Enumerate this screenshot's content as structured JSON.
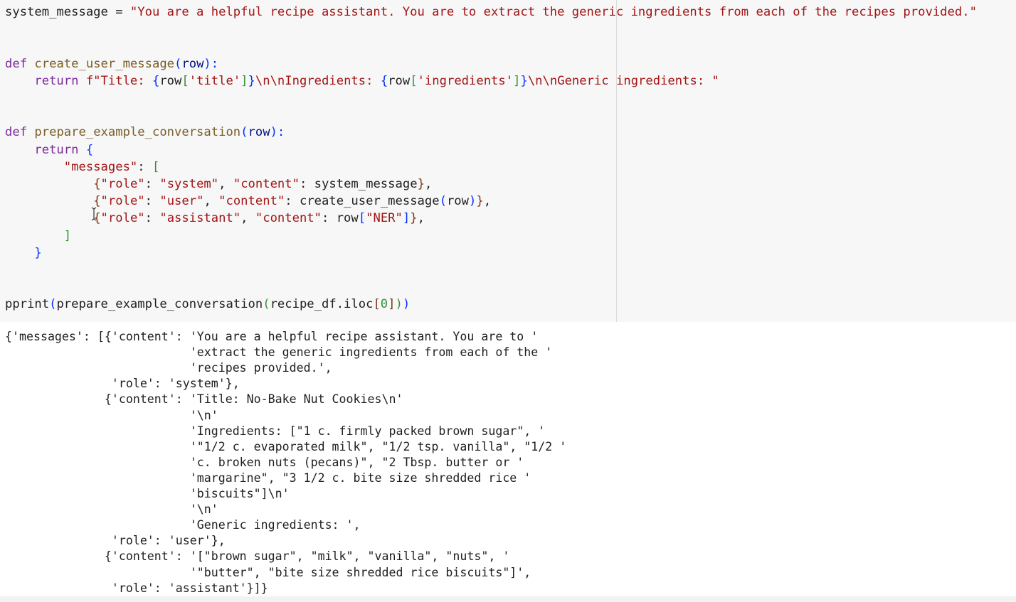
{
  "colors": {
    "plain": "#1f1f1f",
    "string": "#a31515",
    "keyword": "#7c2c9e",
    "function": "#795e26",
    "param": "#001080",
    "bracket_1": "#0431fa",
    "bracket_2": "#319331",
    "bracket_3": "#7b3814",
    "cell_bg": "#f7f7f7"
  },
  "code": [
    [
      {
        "t": "system_message = ",
        "c": "plain"
      },
      {
        "t": "\"You are a helpful recipe assistant. You are to extract the generic ingredients from each of the recipes provided.\"",
        "c": "string"
      }
    ],
    [],
    [],
    [
      {
        "t": "def ",
        "c": "keyword"
      },
      {
        "t": "create_user_message",
        "c": "function"
      },
      {
        "t": "(",
        "c": "bracket_1"
      },
      {
        "t": "row",
        "c": "param"
      },
      {
        "t": "):",
        "c": "bracket_1"
      }
    ],
    [
      {
        "t": "    return ",
        "c": "keyword"
      },
      {
        "t": "f\"Title: ",
        "c": "string"
      },
      {
        "t": "{",
        "c": "bracket_1"
      },
      {
        "t": "row",
        "c": "plain"
      },
      {
        "t": "[",
        "c": "bracket_2"
      },
      {
        "t": "'title'",
        "c": "string"
      },
      {
        "t": "]",
        "c": "bracket_2"
      },
      {
        "t": "}",
        "c": "bracket_1"
      },
      {
        "t": "\\n\\nIngredients: ",
        "c": "string"
      },
      {
        "t": "{",
        "c": "bracket_1"
      },
      {
        "t": "row",
        "c": "plain"
      },
      {
        "t": "[",
        "c": "bracket_2"
      },
      {
        "t": "'ingredients'",
        "c": "string"
      },
      {
        "t": "]",
        "c": "bracket_2"
      },
      {
        "t": "}",
        "c": "bracket_1"
      },
      {
        "t": "\\n\\nGeneric ingredients: \"",
        "c": "string"
      }
    ],
    [],
    [],
    [
      {
        "t": "def ",
        "c": "keyword"
      },
      {
        "t": "prepare_example_conversation",
        "c": "function"
      },
      {
        "t": "(",
        "c": "bracket_1"
      },
      {
        "t": "row",
        "c": "param"
      },
      {
        "t": "):",
        "c": "bracket_1"
      }
    ],
    [
      {
        "t": "    return ",
        "c": "keyword"
      },
      {
        "t": "{",
        "c": "bracket_1"
      }
    ],
    [
      {
        "t": "        ",
        "c": "plain"
      },
      {
        "t": "\"messages\"",
        "c": "string"
      },
      {
        "t": ": ",
        "c": "plain"
      },
      {
        "t": "[",
        "c": "bracket_2"
      }
    ],
    [
      {
        "t": "            ",
        "c": "plain"
      },
      {
        "t": "{",
        "c": "bracket_3"
      },
      {
        "t": "\"role\"",
        "c": "string"
      },
      {
        "t": ": ",
        "c": "plain"
      },
      {
        "t": "\"system\"",
        "c": "string"
      },
      {
        "t": ", ",
        "c": "plain"
      },
      {
        "t": "\"content\"",
        "c": "string"
      },
      {
        "t": ": system_message",
        "c": "plain"
      },
      {
        "t": "}",
        "c": "bracket_3"
      },
      {
        "t": ",",
        "c": "plain"
      }
    ],
    [
      {
        "t": "            ",
        "c": "plain"
      },
      {
        "t": "{",
        "c": "bracket_3"
      },
      {
        "t": "\"role\"",
        "c": "string"
      },
      {
        "t": ": ",
        "c": "plain"
      },
      {
        "t": "\"user\"",
        "c": "string"
      },
      {
        "t": ", ",
        "c": "plain"
      },
      {
        "t": "\"content\"",
        "c": "string"
      },
      {
        "t": ": create_user_message",
        "c": "plain"
      },
      {
        "t": "(",
        "c": "bracket_1"
      },
      {
        "t": "row",
        "c": "plain"
      },
      {
        "t": ")",
        "c": "bracket_1"
      },
      {
        "t": "}",
        "c": "bracket_3"
      },
      {
        "t": ",",
        "c": "plain"
      }
    ],
    [
      {
        "t": "            ",
        "c": "plain"
      },
      {
        "t": "{",
        "c": "bracket_3"
      },
      {
        "t": "\"role\"",
        "c": "string"
      },
      {
        "t": ": ",
        "c": "plain"
      },
      {
        "t": "\"assistant\"",
        "c": "string"
      },
      {
        "t": ", ",
        "c": "plain"
      },
      {
        "t": "\"content\"",
        "c": "string"
      },
      {
        "t": ": row",
        "c": "plain"
      },
      {
        "t": "[",
        "c": "bracket_1"
      },
      {
        "t": "\"NER\"",
        "c": "string"
      },
      {
        "t": "]",
        "c": "bracket_1"
      },
      {
        "t": "}",
        "c": "bracket_3"
      },
      {
        "t": ",",
        "c": "plain"
      }
    ],
    [
      {
        "t": "        ",
        "c": "plain"
      },
      {
        "t": "]",
        "c": "bracket_2"
      }
    ],
    [
      {
        "t": "    ",
        "c": "plain"
      },
      {
        "t": "}",
        "c": "bracket_1"
      }
    ],
    [],
    [],
    [
      {
        "t": "pprint",
        "c": "plain"
      },
      {
        "t": "(",
        "c": "bracket_1"
      },
      {
        "t": "prepare_example_conversation",
        "c": "plain"
      },
      {
        "t": "(",
        "c": "bracket_2"
      },
      {
        "t": "recipe_df.iloc",
        "c": "plain"
      },
      {
        "t": "[",
        "c": "bracket_3"
      },
      {
        "t": "0",
        "c": "bracket_2"
      },
      {
        "t": "]",
        "c": "bracket_3"
      },
      {
        "t": ")",
        "c": "bracket_2"
      },
      {
        "t": ")",
        "c": "bracket_1"
      }
    ]
  ],
  "output": [
    "{'messages': [{'content': 'You are a helpful recipe assistant. You are to '",
    "                          'extract the generic ingredients from each of the '",
    "                          'recipes provided.',",
    "               'role': 'system'},",
    "              {'content': 'Title: No-Bake Nut Cookies\\n'",
    "                          '\\n'",
    "                          'Ingredients: [\"1 c. firmly packed brown sugar\", '",
    "                          '\"1/2 c. evaporated milk\", \"1/2 tsp. vanilla\", \"1/2 '",
    "                          'c. broken nuts (pecans)\", \"2 Tbsp. butter or '",
    "                          'margarine\", \"3 1/2 c. bite size shredded rice '",
    "                          'biscuits\"]\\n'",
    "                          '\\n'",
    "                          'Generic ingredients: ',",
    "               'role': 'user'},",
    "              {'content': '[\"brown sugar\", \"milk\", \"vanilla\", \"nuts\", '",
    "                          '\"butter\", \"bite size shredded rice biscuits\"]',",
    "               'role': 'assistant'}]}"
  ]
}
